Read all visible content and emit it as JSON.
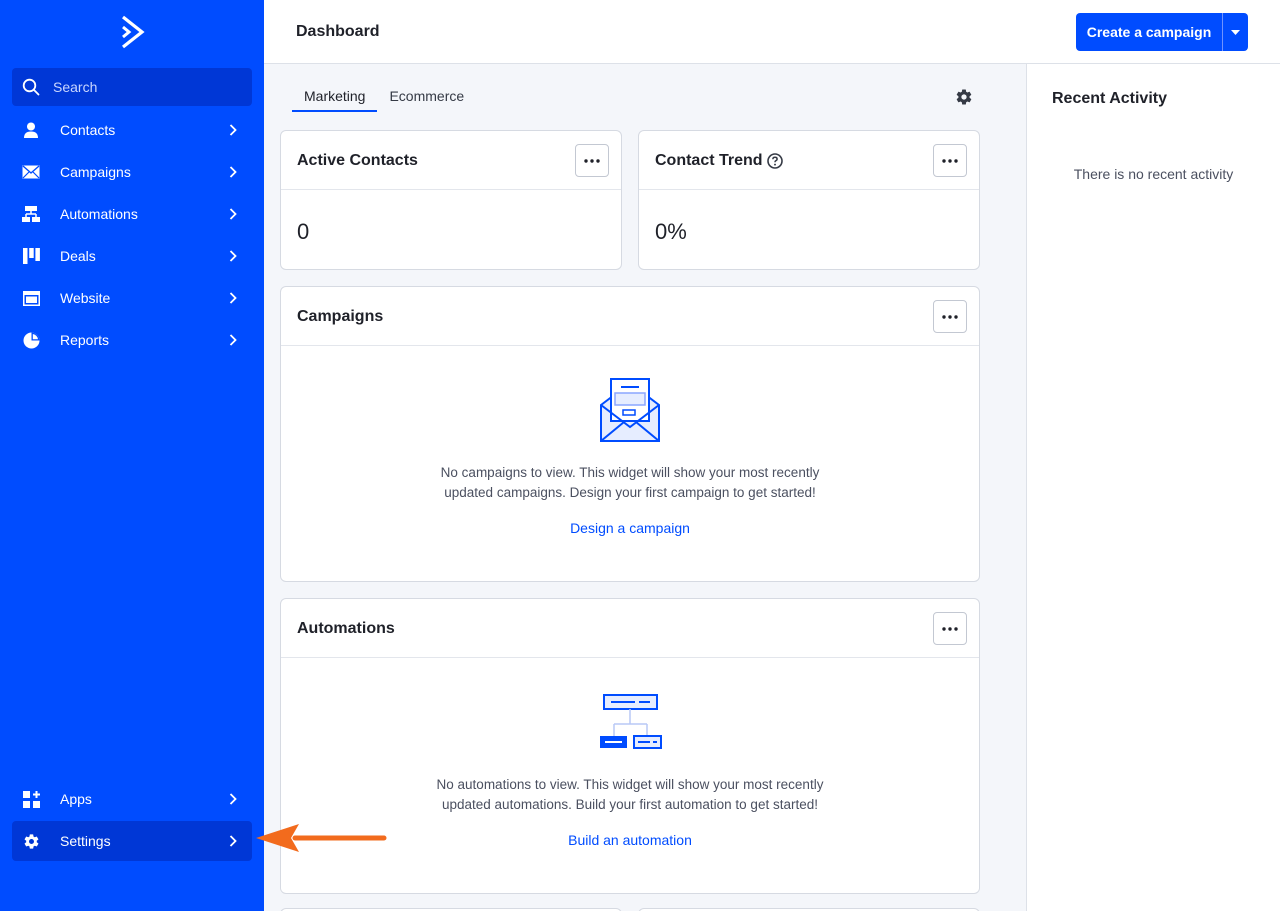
{
  "sidebar": {
    "search_placeholder": "Search",
    "items": [
      {
        "label": "Contacts",
        "icon": "person-icon"
      },
      {
        "label": "Campaigns",
        "icon": "envelope-icon"
      },
      {
        "label": "Automations",
        "icon": "automation-icon"
      },
      {
        "label": "Deals",
        "icon": "deals-icon"
      },
      {
        "label": "Website",
        "icon": "website-icon"
      },
      {
        "label": "Reports",
        "icon": "pie-chart-icon"
      }
    ],
    "bottom_items": [
      {
        "label": "Apps",
        "icon": "apps-icon"
      },
      {
        "label": "Settings",
        "icon": "gear-icon"
      }
    ]
  },
  "header": {
    "title": "Dashboard",
    "create_label": "Create a campaign"
  },
  "tabs": [
    "Marketing",
    "Ecommerce"
  ],
  "cards": {
    "active_contacts": {
      "title": "Active Contacts",
      "value": "0"
    },
    "contact_trend": {
      "title": "Contact Trend",
      "value": "0%"
    },
    "campaigns": {
      "title": "Campaigns",
      "empty_line1": "No campaigns to view. This widget will show your most recently",
      "empty_line2": "updated campaigns. Design your first campaign to get started!",
      "link": "Design a campaign"
    },
    "automations": {
      "title": "Automations",
      "empty_line1": "No automations to view. This widget will show your most recently",
      "empty_line2": "updated automations. Build your first automation to get started!",
      "link": "Build an automation"
    }
  },
  "recent_activity": {
    "title": "Recent Activity",
    "empty": "There is no recent activity"
  },
  "colors": {
    "brand": "#004cff",
    "sidebar_active": "#0037d6",
    "annotation_arrow": "#f26b1d"
  }
}
